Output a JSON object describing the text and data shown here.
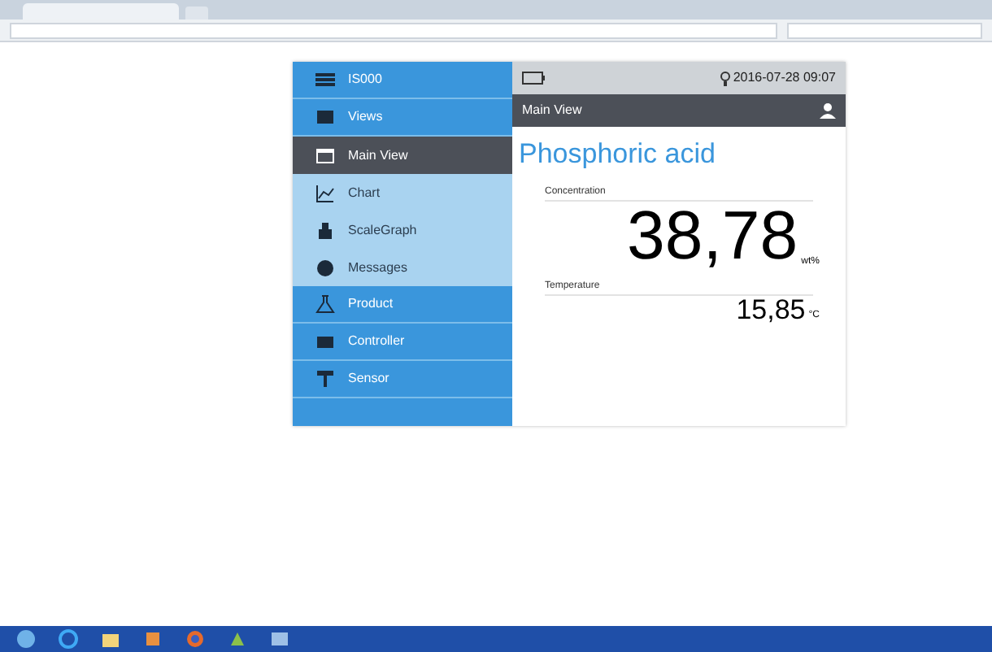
{
  "sidebar": {
    "title": "IS000",
    "items": [
      {
        "label": "Views",
        "kind": "group",
        "selected": false
      },
      {
        "label": "Main View",
        "kind": "sub",
        "selected": true
      },
      {
        "label": "Chart",
        "kind": "sub",
        "selected": false
      },
      {
        "label": "ScaleGraph",
        "kind": "sub",
        "selected": false
      },
      {
        "label": "Messages",
        "kind": "sub",
        "selected": false
      },
      {
        "label": "Product",
        "kind": "group",
        "selected": false
      },
      {
        "label": "Controller",
        "kind": "group",
        "selected": false
      },
      {
        "label": "Sensor",
        "kind": "group",
        "selected": false
      }
    ]
  },
  "topbar": {
    "datetime": "2016-07-28 09:07"
  },
  "view": {
    "title": "Main View",
    "heading": "Phosphoric acid",
    "readings": [
      {
        "label": "Concentration",
        "value": "38,78",
        "unit": "wt%",
        "kind": "large"
      },
      {
        "label": "Temperature",
        "value": "15,85",
        "unit": "°C",
        "kind": "small"
      }
    ]
  }
}
